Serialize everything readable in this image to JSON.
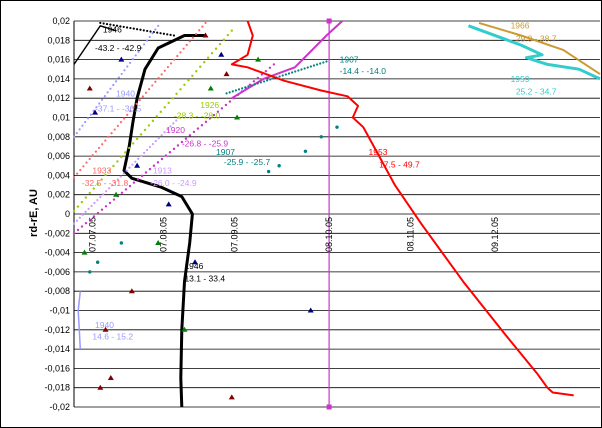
{
  "chart_data": {
    "type": "scatter",
    "title": "",
    "ylabel": "rd-rE, AU",
    "xlabel": "",
    "ylim": [
      -0.02,
      0.02
    ],
    "y_ticks": [
      "0,02",
      "0,018",
      "0,016",
      "0,014",
      "0,012",
      "0,01",
      "0,008",
      "0,006",
      "0,004",
      "0,002",
      "0",
      "-0,002",
      "-0,004",
      "-0,006",
      "-0,008",
      "-0,01",
      "-0,012",
      "-0,014",
      "-0,016",
      "-0,018",
      "-0,02"
    ],
    "x_ticks": [
      "07.07.05",
      "07.08.05",
      "07.09.05",
      "08.10.05",
      "08.11.05",
      "09.12.05"
    ],
    "grid": "horizontal",
    "reference_line": {
      "x_label": "08.10.05",
      "color": "#cc33cc"
    },
    "series": [
      {
        "name": "1946",
        "color": "#000000",
        "labels": [
          "1946",
          "-43.2 - -42.9",
          "1946",
          "13.1 - 33.4"
        ]
      },
      {
        "name": "1940",
        "color": "#9999ff",
        "labels": [
          "1940",
          "-37.1 - -36.5",
          "1940",
          "14.6 - 15.2"
        ]
      },
      {
        "name": "1933",
        "color": "#ff6666",
        "labels": [
          "1933",
          "-32.5 - -31.8"
        ]
      },
      {
        "name": "1926",
        "color": "#99cc00",
        "labels": [
          "1926",
          "-28.3 - -28.0"
        ]
      },
      {
        "name": "1920",
        "color": "#cc33cc",
        "labels": [
          "1920",
          "-26.8 - -25.9"
        ]
      },
      {
        "name": "1913",
        "color": "#cc99ff",
        "labels": [
          "1913",
          "-26.0 - -24.9"
        ]
      },
      {
        "name": "1907",
        "color": "#008080",
        "labels": [
          "1907",
          "-25.9 - -25.7",
          "1907",
          "-14.4 - -14.0"
        ]
      },
      {
        "name": "1953",
        "color": "#ff0000",
        "labels": [
          "1953",
          "17.5 - 49.7"
        ]
      },
      {
        "name": "1966",
        "color": "#cc9933",
        "labels": [
          "1966",
          "29.9 - 38.7"
        ]
      },
      {
        "name": "1959",
        "color": "#33cccc",
        "labels": [
          "1959",
          "25.2 - 34.7"
        ]
      },
      {
        "name": "",
        "color": "#800000",
        "labels": []
      },
      {
        "name": "",
        "color": "#000080",
        "labels": []
      },
      {
        "name": "",
        "color": "#008000",
        "labels": []
      }
    ]
  }
}
